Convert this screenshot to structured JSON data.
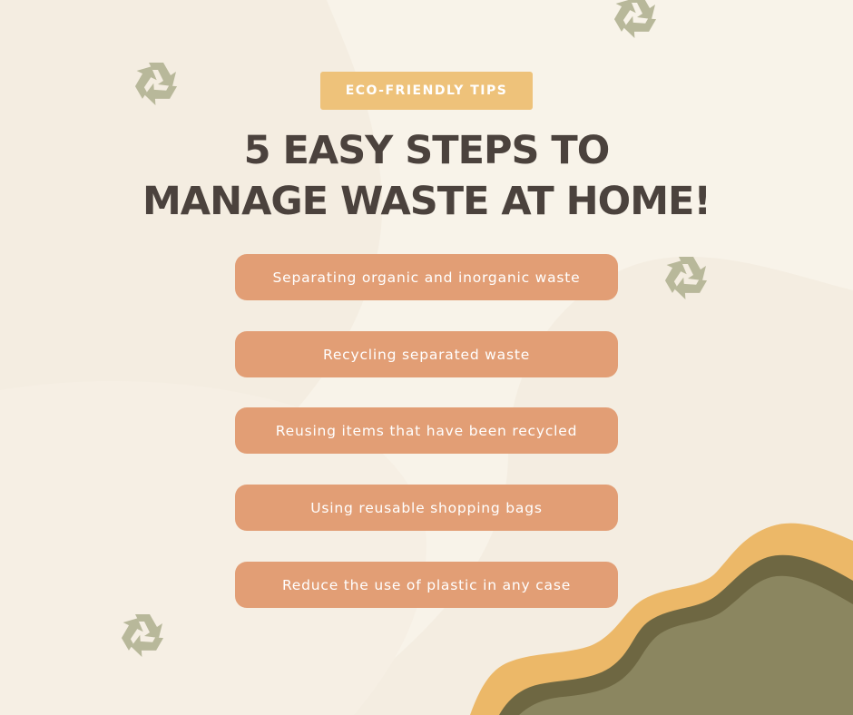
{
  "badge": {
    "label": "ECO-FRIENDLY TIPS"
  },
  "title": {
    "line1": "5 EASY STEPS TO",
    "line2": "MANAGE WASTE AT HOME!"
  },
  "steps": [
    {
      "label": "Separating organic and inorganic waste"
    },
    {
      "label": "Recycling separated waste"
    },
    {
      "label": "Reusing items that have been recycled"
    },
    {
      "label": "Using reusable shopping bags"
    },
    {
      "label": "Reduce the use of plastic in any case"
    }
  ],
  "icons": {
    "recycle": "recycle-icon"
  },
  "colors": {
    "background": "#F4EDE1",
    "background_light": "#F8F3E9",
    "badge": "#EEC27A",
    "title": "#4B423D",
    "step": "#E29E75",
    "step_text": "#FFFFFF",
    "hill_orange": "#ECB868",
    "hill_dark": "#6E6742",
    "hill_green": "#8B8660",
    "recycle_icon": "#B8B89A"
  }
}
